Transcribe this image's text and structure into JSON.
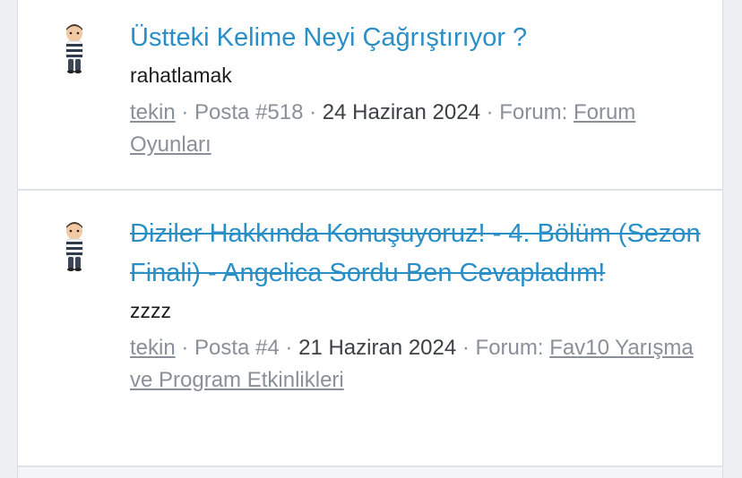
{
  "results": [
    {
      "title": "Üstteki Kelime Neyi Çağrıştırıyor ?",
      "snippet": "rahatlamak",
      "author": "tekin",
      "post_label": "Posta #518",
      "date": "24 Haziran 2024",
      "forum_prefix": "Forum:",
      "forum_name": "Forum Oyunları",
      "struck": false
    },
    {
      "title": "Diziler Hakkında Konuşuyoruz! - 4. Bölüm (Sezon Finali) - Angelica Sordu Ben Cevapladım!",
      "snippet": "zzzz",
      "author": "tekin",
      "post_label": "Posta #4",
      "date": "21 Haziran 2024",
      "forum_prefix": "Forum:",
      "forum_name": "Fav10 Yarışma ve Program Etkinlikleri",
      "struck": true
    }
  ],
  "colors": {
    "link": "#2b8fc7",
    "meta": "#8a9098",
    "text": "#1c1c1c"
  },
  "icons": {
    "avatar": "user-avatar-icon"
  }
}
